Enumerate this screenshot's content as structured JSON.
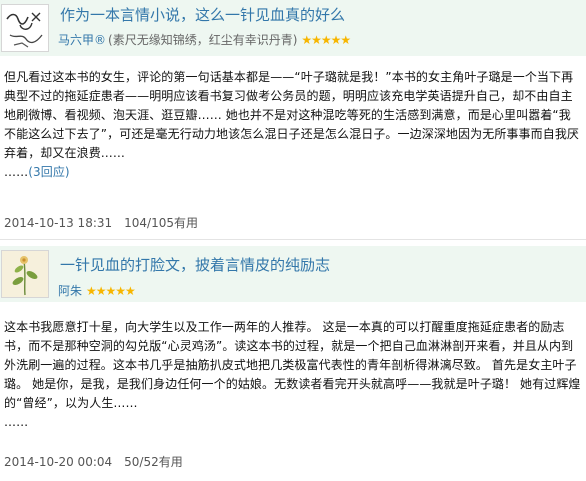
{
  "reviews": [
    {
      "title": "作为一本言情小说，这么一针见血真的好么",
      "author": "马六甲®",
      "signature": "(素尺无缘知锦绣，红尘有幸识丹青)",
      "stars": "★★★★★",
      "rating_value": 5,
      "body": "但凡看过这本书的女生，评论的第一句话基本都是——“叶子璐就是我！”本书的女主角叶子璐是一个当下再典型不过的拖延症患者——明明应该看书复习做考公务员的题，明明应该充电学英语提升自己，却不由自主地刷微博、看视频、泡天涯、逛豆瓣…… 她也并不是对这种混吃等死的生活感到满意，而是心里叫嚣着“我不能这么过下去了”，可还是毫无行动力地该怎么混日子还是怎么混日子。一边深深地因为无所事事而自我厌弃着，却又在浪费……",
      "more": "(3回应)",
      "dots": "……",
      "date": "2014-10-13 18:31",
      "useful": "104/105有用"
    },
    {
      "title": "一针见血的打脸文，披着言情皮的纯励志",
      "author": "阿朱",
      "signature": "",
      "stars": "★★★★★",
      "rating_value": 5,
      "body": "这本书我愿意打十星，向大学生以及工作一两年的人推荐。 这是一本真的可以打醒重度拖延症患者的励志书，而不是那种空洞的勾兑版“心灵鸡汤”。读这本书的过程，就是一个把自己血淋淋剖开来看，并且从内到外洗刷一遍的过程。这本书几乎是抽筋扒皮式地把几类极富代表性的青年剖析得淋漓尽致。 首先是女主叶子璐。 她是你，是我，是我们身边任何一个的姑娘。无数读者看完开头就高呼——我就是叶子璐！ 她有过辉煌的“曾经”，以为人生……",
      "dots": "……",
      "date": "2014-10-20 00:04",
      "useful": "50/52有用"
    }
  ]
}
